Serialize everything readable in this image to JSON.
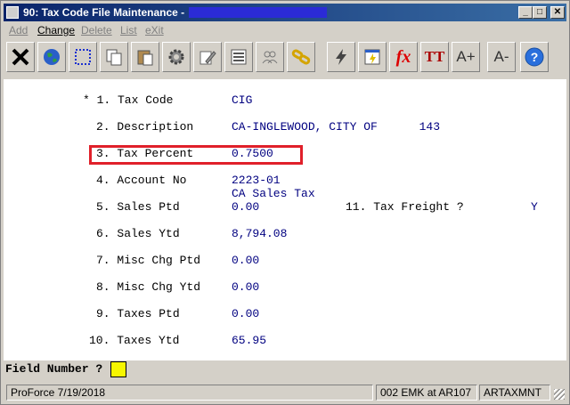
{
  "window": {
    "title": "90: Tax Code File Maintenance -",
    "minimize": "_",
    "maximize": "□",
    "close": "✕"
  },
  "menu": [
    {
      "label": "Add",
      "enabled": false
    },
    {
      "label": "Change",
      "enabled": true
    },
    {
      "label": "Delete",
      "enabled": false
    },
    {
      "label": "List",
      "enabled": false
    },
    {
      "label": "eXit",
      "enabled": false
    }
  ],
  "toolbar": {
    "icons": [
      "close-x-icon",
      "globe-icon",
      "select-box-icon",
      "copy-icon",
      "paste-icon",
      "settings-gear-icon",
      "edit-pencil-icon",
      "list-view-icon",
      "users-icon",
      "chain-link-icon",
      "lightning-icon",
      "report-icon",
      "function-icon",
      "font-icon",
      "font-increase-icon",
      "font-decrease-icon",
      "help-icon"
    ],
    "function_label": "fx",
    "font_label": "TT",
    "font_inc_label": "A+",
    "font_dec_label": "A-",
    "help_label": "?"
  },
  "fields": {
    "f1": {
      "label": "* 1. Tax Code",
      "value": "CIG"
    },
    "f2": {
      "label": "2. Description",
      "value": "CA-INGLEWOOD, CITY OF      143"
    },
    "f3": {
      "label": "3. Tax Percent",
      "value": "0.7500"
    },
    "f4": {
      "label": "4. Account No",
      "value": "2223-01",
      "sub": "CA Sales Tax"
    },
    "f5": {
      "label": "5. Sales Ptd",
      "value": "0.00"
    },
    "f11": {
      "label": "11. Tax Freight ?",
      "value": "Y"
    },
    "f6": {
      "label": "6. Sales Ytd",
      "value": "8,794.08"
    },
    "f7": {
      "label": "7. Misc Chg Ptd",
      "value": "0.00"
    },
    "f8": {
      "label": "8. Misc Chg Ytd",
      "value": "0.00"
    },
    "f9": {
      "label": "9. Taxes Ptd",
      "value": "0.00"
    },
    "f10": {
      "label": "10. Taxes Ytd",
      "value": "65.95"
    }
  },
  "prompt": {
    "label": "Field Number ?",
    "value": ""
  },
  "status": {
    "left": "ProForce 7/19/2018",
    "middle": "002 EMK at AR107",
    "right": "ARTAXMNT"
  }
}
